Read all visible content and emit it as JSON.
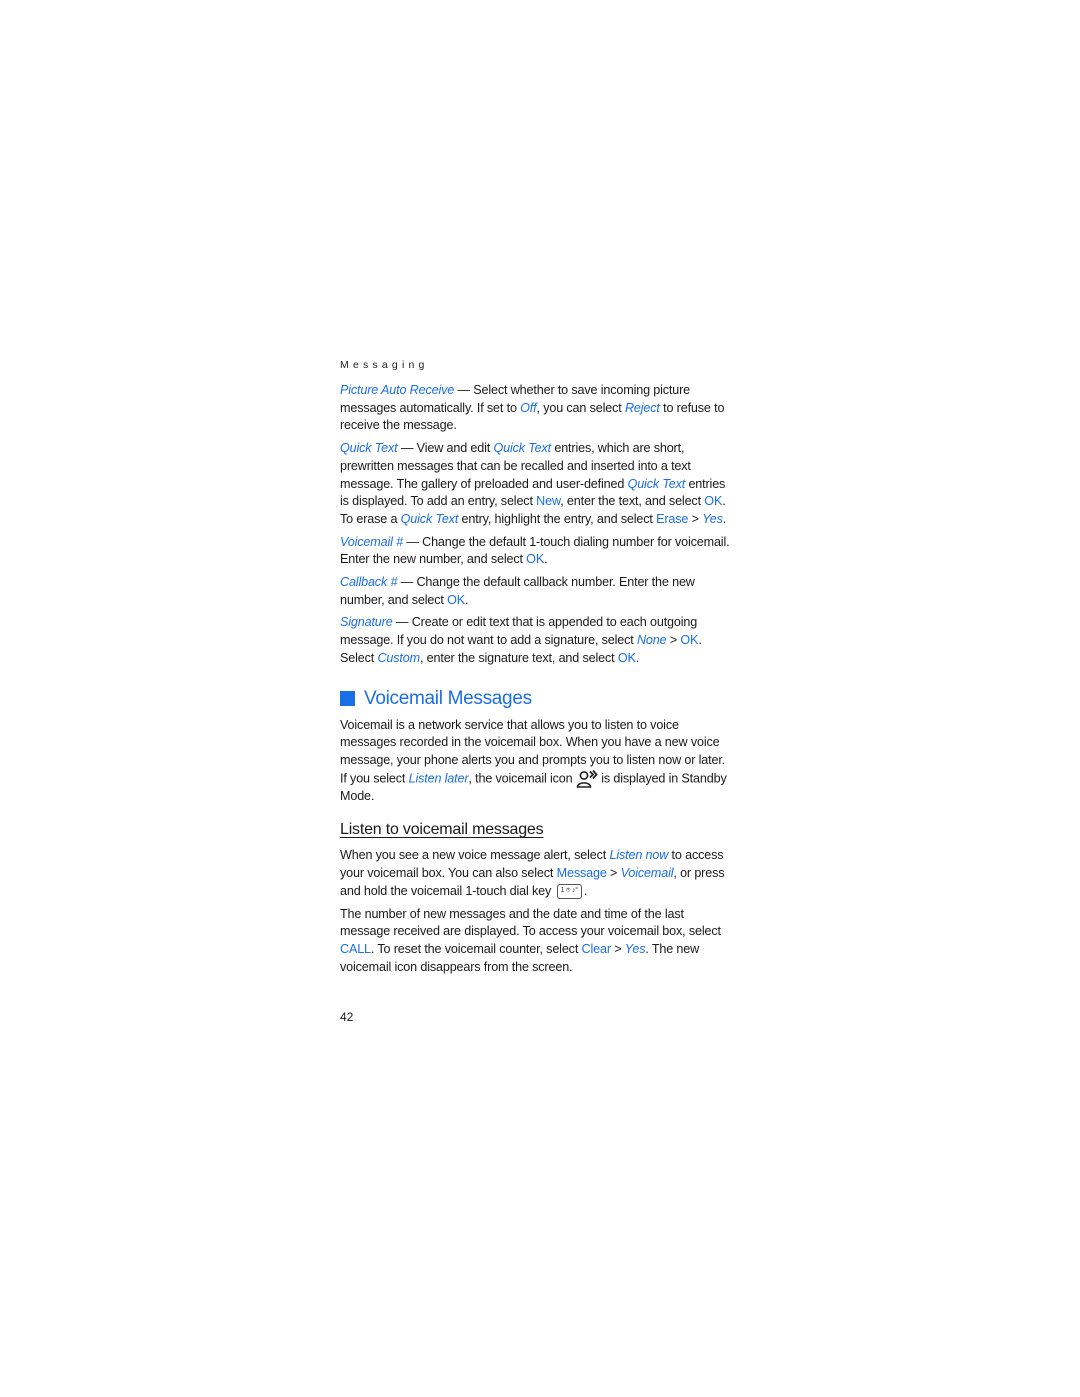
{
  "header": {
    "running_title": "Messaging"
  },
  "settings": {
    "picture_auto_receive": {
      "term": "Picture Auto Receive",
      "t1": " — Select whether to save incoming picture messages automatically. If set to ",
      "off": "Off",
      "t2": ", you can select ",
      "reject": "Reject",
      "t3": " to refuse to receive the message."
    },
    "quick_text": {
      "term": "Quick Text",
      "t1": " — View and edit ",
      "term2": "Quick Text",
      "t2": " entries, which are short, prewritten messages that can be recalled and inserted into a text message. The gallery of preloaded and user-defined ",
      "term3": "Quick Text",
      "t3": " entries is displayed. To add an entry, select ",
      "new": "New",
      "t4": ", enter the text, and select ",
      "ok": "OK",
      "t5": ". To erase a ",
      "term4": "Quick Text",
      "t6": " entry, highlight the entry, and select ",
      "erase": "Erase",
      "t7": " > ",
      "yes": "Yes",
      "t8": "."
    },
    "voicemail_number": {
      "term": "Voicemail #",
      "t1": " — Change the default 1-touch dialing number for voicemail. Enter the new number, and select ",
      "ok": "OK",
      "t2": "."
    },
    "callback_number": {
      "term": "Callback #",
      "t1": " — Change the default callback number. Enter the new number, and select ",
      "ok": "OK",
      "t2": "."
    },
    "signature": {
      "term": "Signature",
      "t1": " — Create or edit text that is appended to each outgoing message. If you do not want to add a signature, select ",
      "none": "None",
      "t2": " > ",
      "ok": "OK",
      "t3": ". Select ",
      "custom": "Custom",
      "t4": ", enter the signature text, and select ",
      "ok2": "OK",
      "t5": "."
    }
  },
  "voicemail_section": {
    "title": "Voicemail Messages",
    "intro": {
      "t1": "Voicemail is a network service that allows you to listen to voice messages recorded in the voicemail box. When you have a new voice message, your phone alerts you and prompts you to listen now or later. If you select ",
      "listen_later": "Listen later",
      "t2": ", the voicemail icon ",
      "t3": " is displayed in Standby Mode."
    },
    "icon": "voicemail-icon"
  },
  "listen_section": {
    "title": "Listen to voicemail messages",
    "p1": {
      "t1": "When you see a new voice message alert, select ",
      "listen_now": "Listen now",
      "t2": " to access your voicemail box. You can also select ",
      "message": "Message",
      "t3": " > ",
      "voicemail": "Voicemail",
      "t4": ", or press and hold the voicemail 1-touch dial key ",
      "key_label": "1 ⌾ ♪°",
      "t5": "."
    },
    "p2": {
      "t1": "The number of new messages and the date and time of the last message received are displayed. To access your voicemail box, select ",
      "call": "CALL",
      "t2": ". To reset the voicemail counter, select ",
      "clear": "Clear",
      "t3": " > ",
      "yes": "Yes",
      "t4": ". The new voicemail icon disappears from the screen."
    }
  },
  "footer": {
    "page_number": "42"
  },
  "colors": {
    "accent": "#1a6ee6",
    "text": "#1a1a1a"
  }
}
